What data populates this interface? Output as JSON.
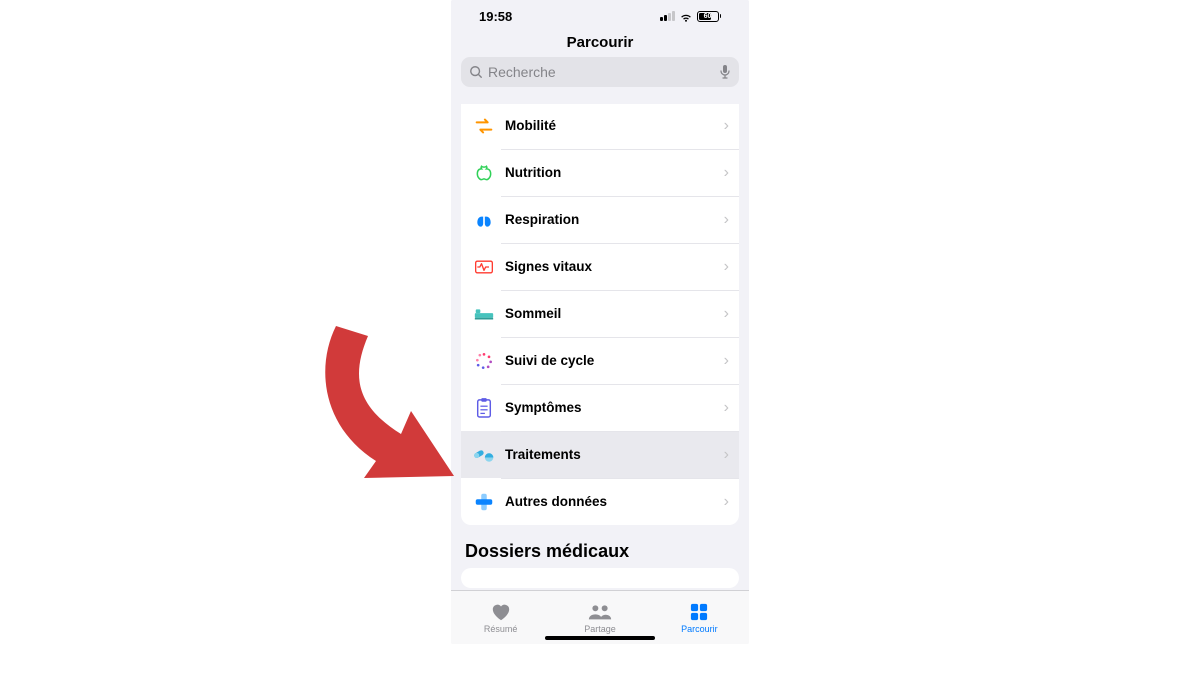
{
  "status": {
    "time": "19:58",
    "battery": "60"
  },
  "nav": {
    "title": "Parcourir"
  },
  "search": {
    "placeholder": "Recherche"
  },
  "categories": {
    "items": [
      {
        "label": "Mobilité",
        "icon": "mobility-icon",
        "color": "#ff9500"
      },
      {
        "label": "Nutrition",
        "icon": "nutrition-icon",
        "color": "#30d158"
      },
      {
        "label": "Respiration",
        "icon": "respiration-icon",
        "color": "#0a84ff"
      },
      {
        "label": "Signes vitaux",
        "icon": "vitals-icon",
        "color": "#ff3b30"
      },
      {
        "label": "Sommeil",
        "icon": "sleep-icon",
        "color": "#46c3bd"
      },
      {
        "label": "Suivi de cycle",
        "icon": "cycle-icon",
        "color": "#b24cc1"
      },
      {
        "label": "Symptômes",
        "icon": "symptoms-icon",
        "color": "#5e5ce6"
      },
      {
        "label": "Traitements",
        "icon": "medications-icon",
        "color": "#33aee0",
        "highlighted": true
      },
      {
        "label": "Autres données",
        "icon": "other-icon",
        "color": "#0a84ff"
      }
    ]
  },
  "section2": {
    "title": "Dossiers médicaux"
  },
  "tabs": {
    "resume": "Résumé",
    "partage": "Partage",
    "parcourir": "Parcourir"
  }
}
